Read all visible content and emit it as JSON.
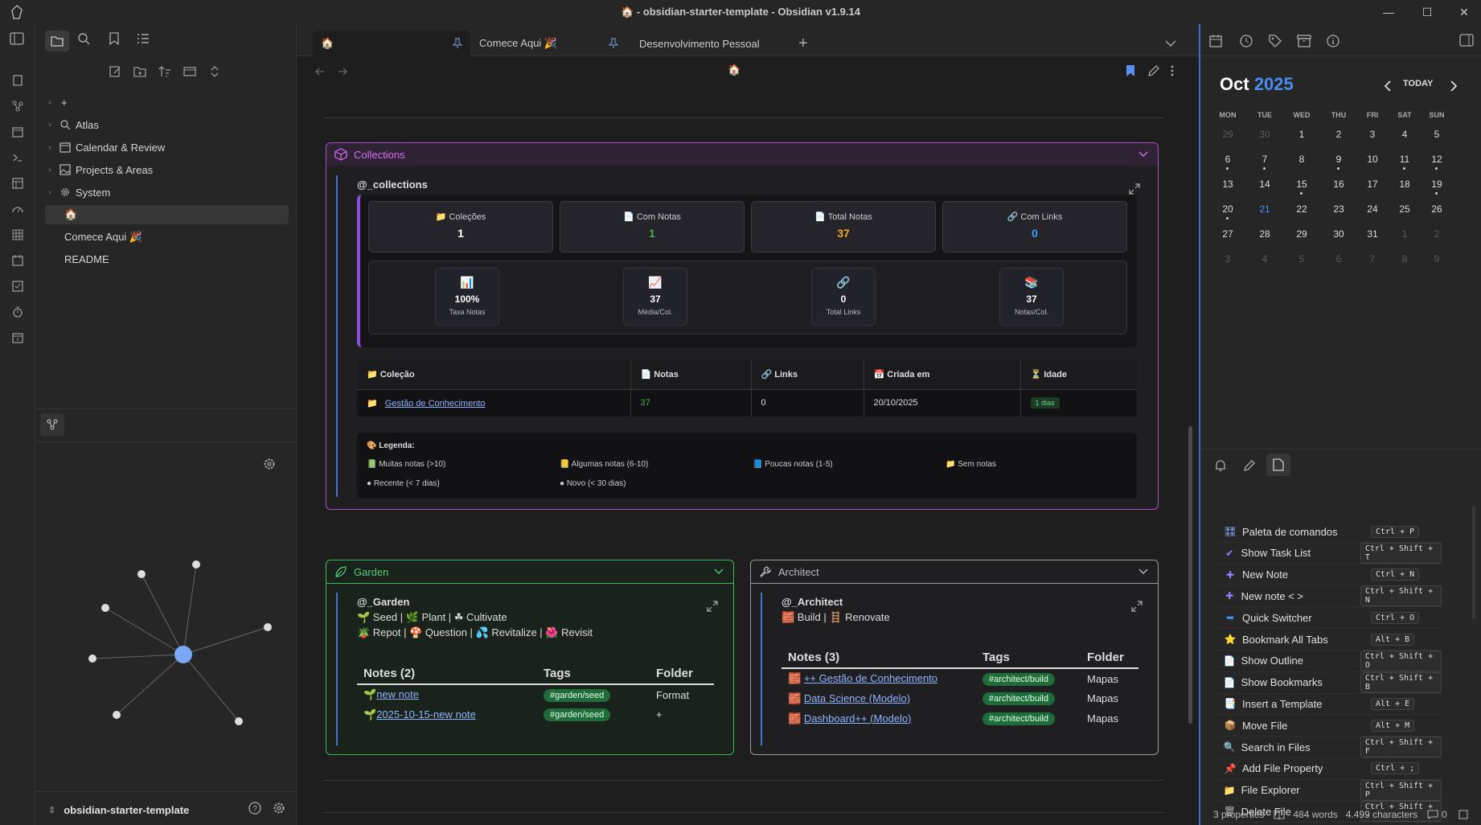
{
  "window": {
    "title": "🏠 - obsidian-starter-template - Obsidian v1.9.14",
    "minimize": "—",
    "maximize": "☐",
    "close": "✕"
  },
  "left": {
    "tree": [
      {
        "label": "+",
        "chevron": "›"
      },
      {
        "label": "Atlas",
        "chevron": "›",
        "icon": "atlas-icon"
      },
      {
        "label": "Calendar & Review",
        "chevron": "›",
        "icon": "calendar-icon"
      },
      {
        "label": "Projects & Areas",
        "chevron": "›",
        "icon": "image-icon"
      },
      {
        "label": "System",
        "chevron": "›",
        "icon": "gear-icon"
      },
      {
        "label": "🏠"
      },
      {
        "label": "Comece Aqui 🎉"
      },
      {
        "label": "README"
      }
    ],
    "vault_name": "obsidian-starter-template"
  },
  "tabs": [
    {
      "label": "🏠"
    },
    {
      "label": "Comece Aqui 🎉"
    },
    {
      "label": "Desenvolvimento Pessoal"
    }
  ],
  "note": {
    "title_emoji": "🏠",
    "collections": {
      "header": "Collections",
      "code_title": "@_collections",
      "stats": [
        {
          "label": "📁 Coleções",
          "value": "1",
          "color": "#ffffff"
        },
        {
          "label": "📄 Com Notas",
          "value": "1",
          "color": "#4caf50"
        },
        {
          "label": "📄 Total Notas",
          "value": "37",
          "color": "#f5a623"
        },
        {
          "label": "🔗 Com Links",
          "value": "0",
          "color": "#3d9bff"
        }
      ],
      "mini": [
        {
          "icon": "📊",
          "value": "100%",
          "label": "Taxa Notas"
        },
        {
          "icon": "📈",
          "value": "37",
          "label": "Média/Col."
        },
        {
          "icon": "🔗",
          "value": "0",
          "label": "Total Links"
        },
        {
          "icon": "📚",
          "value": "37",
          "label": "Notas/Col."
        }
      ],
      "table": {
        "headers": [
          "📁 Coleção",
          "📄 Notas",
          "🔗 Links",
          "📅 Criada em",
          "⏳ Idade"
        ],
        "row": {
          "icon": "📁",
          "name": "Gestão de Conhecimento",
          "notas": "37",
          "links": "0",
          "criada": "20/10/2025",
          "idade": "1 dias"
        }
      },
      "legend": {
        "title": "🎨 Legenda:",
        "items": [
          "📗 Muitas notas (>10)",
          "📒 Algumas notas (6-10)",
          "📘 Poucas notas (1-5)",
          "📁 Sem notas"
        ],
        "items2": [
          "● Recente (< 7 dias)",
          "● Novo (< 30 dias)"
        ]
      }
    },
    "garden": {
      "header": "Garden",
      "code_title": "@_Garden",
      "line1": "🌱 Seed | 🌿 Plant | ☘ Cultivate",
      "line2": "🪴 Repot | 🍄 Question | 💦 Revitalize | 🌺 Revisit",
      "table_headers": [
        "Notes (2)",
        "Tags",
        "Folder"
      ],
      "rows": [
        {
          "icon": "🌱",
          "name": "new note",
          "tag": "#garden/seed",
          "folder": "Format"
        },
        {
          "icon": "🌱",
          "name": "2025-10-15-new note",
          "tag": "#garden/seed",
          "folder": "+"
        }
      ]
    },
    "architect": {
      "header": "Architect",
      "code_title": "@_Architect",
      "line1": "🧱 Build | 🪜 Renovate",
      "table_headers": [
        "Notes (3)",
        "Tags",
        "Folder"
      ],
      "rows": [
        {
          "icon": "🧱",
          "name": "++ Gestão de Conhecimento",
          "tag": "#architect/build",
          "folder": "Mapas"
        },
        {
          "icon": "🧱",
          "name": "Data Science (Modelo)",
          "tag": "#architect/build",
          "folder": "Mapas"
        },
        {
          "icon": "🧱",
          "name": "Dashboard++ (Modelo)",
          "tag": "#architect/build",
          "folder": "Mapas"
        }
      ]
    }
  },
  "calendar": {
    "month": "Oct",
    "year": "2025",
    "today_label": "TODAY",
    "weekdays": [
      "MON",
      "TUE",
      "WED",
      "THU",
      "FRI",
      "SAT",
      "SUN"
    ],
    "weeks": [
      [
        "29",
        "30",
        "1",
        "2",
        "3",
        "4",
        "5"
      ],
      [
        "6",
        "7",
        "8",
        "9",
        "10",
        "11",
        "12"
      ],
      [
        "13",
        "14",
        "15",
        "16",
        "17",
        "18",
        "19"
      ],
      [
        "20",
        "21",
        "22",
        "23",
        "24",
        "25",
        "26"
      ],
      [
        "27",
        "28",
        "29",
        "30",
        "31",
        "1",
        "2"
      ],
      [
        "3",
        "4",
        "5",
        "6",
        "7",
        "8",
        "9"
      ]
    ],
    "accent": "#4a8df0"
  },
  "commands": [
    {
      "icon": "🎛",
      "name": "Paleta de comandos",
      "keys": "Ctrl + P",
      "color": "#8ab4ff"
    },
    {
      "icon": "✔",
      "name": "Show Task List",
      "keys": "Ctrl + Shift + T",
      "color": "#9b7dff"
    },
    {
      "icon": "✚",
      "name": "New Note",
      "keys": "Ctrl + N",
      "color": "#9b7dff"
    },
    {
      "icon": "✚",
      "name": "New note < >",
      "keys": "Ctrl + Shift + N",
      "color": "#9b7dff"
    },
    {
      "icon": "➡",
      "name": "Quick Switcher",
      "keys": "Ctrl + O",
      "color": "#3d9bff"
    },
    {
      "icon": "⭐",
      "name": "Bookmark All Tabs",
      "keys": "Alt + B",
      "color": "#f5c518"
    },
    {
      "icon": "📄",
      "name": "Show Outline",
      "keys": "Ctrl + Shift + O",
      "color": "#ddd"
    },
    {
      "icon": "📄",
      "name": "Show Bookmarks",
      "keys": "Ctrl + Shift + B",
      "color": "#ddd"
    },
    {
      "icon": "📑",
      "name": "Insert a Template",
      "keys": "Alt + E",
      "color": "#f5a623"
    },
    {
      "icon": "📦",
      "name": "Move File",
      "keys": "Alt + M",
      "color": "#c08040"
    },
    {
      "icon": "🔍",
      "name": "Search in Files",
      "keys": "Ctrl + Shift + F",
      "color": "#3d9bff"
    },
    {
      "icon": "📌",
      "name": "Add File Property",
      "keys": "Ctrl + ;",
      "color": "#e74c3c"
    },
    {
      "icon": "📁",
      "name": "File Explorer",
      "keys": "Ctrl + Shift + P",
      "color": "#f5c518"
    },
    {
      "icon": "🗑",
      "name": "Delete File",
      "keys": "Ctrl + Shift + -",
      "color": "#aaa"
    }
  ],
  "status": {
    "properties": "3 properties",
    "words": "484 words",
    "chars": "4.499 characters",
    "comments": "0"
  }
}
